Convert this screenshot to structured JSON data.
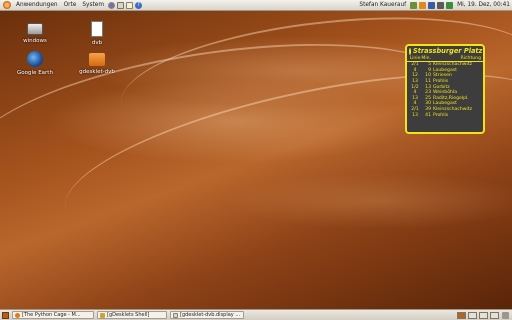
{
  "top_panel": {
    "menus": [
      "Anwendungen",
      "Orte",
      "System"
    ],
    "user": "Stefan Kauerauf",
    "clock": "Mi, 19. Dez, 00:41",
    "launchers": [
      "firefox-icon",
      "mail-icon",
      "notes-icon",
      "help-icon"
    ],
    "tray": [
      "network-icon",
      "update-icon",
      "bluetooth-icon",
      "volume-icon",
      "battery-icon"
    ]
  },
  "desktop_icons": [
    {
      "label": "windows",
      "icon": "drive-icon"
    },
    {
      "label": "dvb",
      "icon": "document-icon"
    },
    {
      "label": "Google Earth",
      "icon": "google-earth-icon"
    },
    {
      "label": "gdesklet-dvb",
      "icon": "folder-icon"
    }
  ],
  "desklet": {
    "title": "Strassburger Platz",
    "headers": {
      "line": "Linie",
      "min": "Min.",
      "dir": "Richtung"
    },
    "rows": [
      {
        "line": "2/1",
        "min": "5",
        "dir": "Kleinzschachwitz"
      },
      {
        "line": "4",
        "min": "9",
        "dir": "Laubegast"
      },
      {
        "line": "12",
        "min": "10",
        "dir": "Striesen"
      },
      {
        "line": "13",
        "min": "11",
        "dir": "Prohlis"
      },
      {
        "line": "1/2",
        "min": "13",
        "dir": "Gorbitz"
      },
      {
        "line": "4",
        "min": "23",
        "dir": "Weinböhla"
      },
      {
        "line": "13",
        "min": "25",
        "dir": "Raditz,Riegelpl."
      },
      {
        "line": "4",
        "min": "30",
        "dir": "Laubegast"
      },
      {
        "line": "2/1",
        "min": "39",
        "dir": "Kleinzschachwitz"
      },
      {
        "line": "13",
        "min": "41",
        "dir": "Prohlis"
      }
    ]
  },
  "taskbar": {
    "tasks": [
      "[The Python Cage - M...",
      "[gDesklets Shell]",
      "[gdesklet-dvb.display ..."
    ]
  },
  "colors": {
    "desklet_accent": "#f2e21e",
    "desklet_bg": "#3d3d3d"
  }
}
